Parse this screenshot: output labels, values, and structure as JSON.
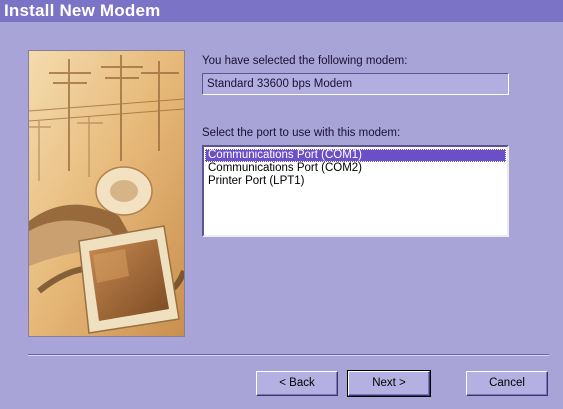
{
  "window": {
    "title": "Install New Modem"
  },
  "selected_modem": {
    "label": "You have selected the following modem:",
    "value": "Standard 33600 bps Modem"
  },
  "port_select": {
    "label": "Select the port to use with this modem:",
    "options": [
      "Communications Port (COM1)",
      "Communications Port (COM2)",
      "Printer Port (LPT1)"
    ],
    "selected": "Communications Port (COM1)"
  },
  "buttons": {
    "back": "< Back",
    "next": "Next >",
    "cancel": "Cancel"
  },
  "colors": {
    "window_bg": "#a8a4d8",
    "titlebar_bg": "#7b73c6",
    "selection": "#6a4fc8"
  },
  "wizard_image": {
    "depicts": "modem-utility-poles-monitor-illustration"
  }
}
